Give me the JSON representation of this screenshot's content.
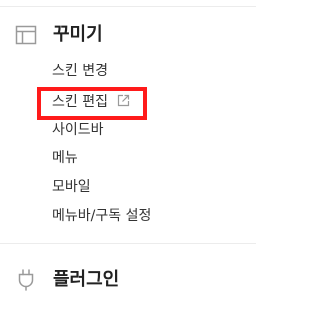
{
  "sections": [
    {
      "icon": "layout-icon",
      "title": "꾸미기",
      "items": [
        {
          "label": "스킨 변경"
        },
        {
          "label": "스킨 편집",
          "icon": "external-link-icon",
          "highlighted": true
        },
        {
          "label": "사이드바"
        },
        {
          "label": "메뉴"
        },
        {
          "label": "모바일"
        },
        {
          "label": "메뉴바/구독 설정"
        }
      ]
    },
    {
      "icon": "plug-icon",
      "title": "플러그인"
    }
  ],
  "colors": {
    "highlight": "#ff1a1a",
    "icon": "#9a9a9a",
    "divider": "#ececec"
  }
}
